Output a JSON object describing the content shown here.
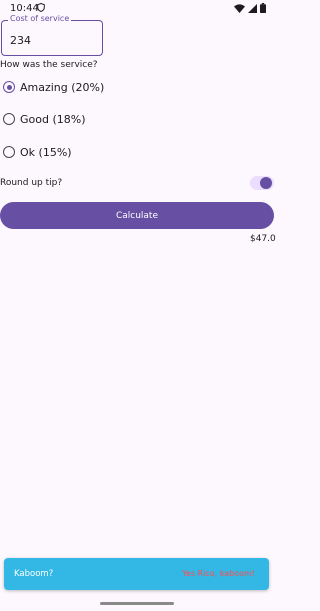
{
  "status_bar": {
    "time": "10:44",
    "icons": [
      "shield-icon",
      "wifi-icon",
      "signal-icon",
      "battery-icon"
    ]
  },
  "cost_field": {
    "label": "Cost of service",
    "value": "234"
  },
  "service_question": "How was the service?",
  "tip_options": [
    {
      "label": "Amazing (20%)",
      "selected": true
    },
    {
      "label": "Good (18%)",
      "selected": false
    },
    {
      "label": "Ok (15%)",
      "selected": false
    }
  ],
  "round_up": {
    "label": "Round up tip?",
    "on": true
  },
  "calculate_label": "Calculate",
  "tip_amount": "$47.0",
  "snackbar": {
    "message": "Kaboom?",
    "action": "Yes Rico, kaboom!"
  },
  "colors": {
    "accent": "#6750a4",
    "background": "#fdf7fe",
    "snackbar_bg": "#33b8e6",
    "snackbar_action": "#ff4d4d"
  }
}
